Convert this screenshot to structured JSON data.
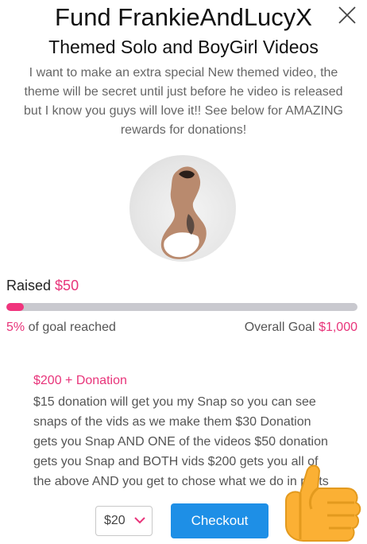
{
  "header": {
    "title": "Fund FrankieAndLucyX",
    "subtitle": "Themed Solo and BoyGirl Videos",
    "description": "I want to make an extra special New themed video, the theme will be secret until just before he video is released but I know you guys will love it!! See below for AMAZING rewards for donations!"
  },
  "progress": {
    "raised_label": "Raised",
    "raised_amount": "$50",
    "percent_value": 5,
    "percent_text": "5%",
    "percent_suffix": " of goal reached",
    "goal_label": "Overall Goal",
    "goal_amount": "$1,000"
  },
  "reward": {
    "title": "$200 + Donation",
    "body": "$15 donation will get you my Snap so you can see snaps of the vids as we make them $30 Donation gets you Snap AND ONE of the videos $50 donation gets you Snap and BOTH vids $200 gets you all of the above AND you get to chose what we do in parts of the video"
  },
  "footer": {
    "amount_selected": "$20",
    "checkout_label": "Checkout"
  },
  "icons": {
    "close": "close-icon",
    "chevron": "chevron-down-icon",
    "thumb": "thumbs-up-emoji"
  },
  "colors": {
    "accent": "#e8347a",
    "button": "#1e8fe6",
    "track": "#c9c9cf"
  }
}
